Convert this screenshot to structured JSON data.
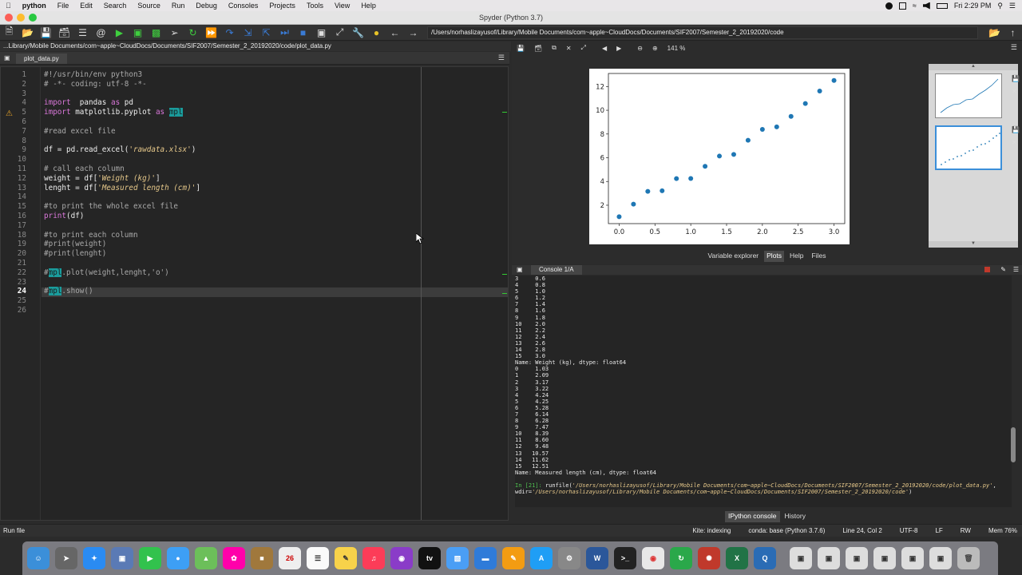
{
  "menubar": {
    "app": "python",
    "items": [
      "File",
      "Edit",
      "Search",
      "Source",
      "Run",
      "Debug",
      "Consoles",
      "Projects",
      "Tools",
      "View",
      "Help"
    ],
    "clock": "Fri 2:29 PM"
  },
  "window": {
    "title": "Spyder (Python 3.7)"
  },
  "toolbar": {
    "working_dir": "/Users/norhaslizayusof/Library/Mobile Documents/com~apple~CloudDocs/Documents/SIF2007/Semester_2_20192020/code"
  },
  "editor": {
    "file_path": "...Library/Mobile Documents/com~apple~CloudDocs/Documents/SIF2007/Semester_2_20192020/code/plot_data.py",
    "tab": "plot_data.py",
    "current_line": 24
  },
  "plots": {
    "zoom": "141 %",
    "tabs": [
      "Variable explorer",
      "Plots",
      "Help",
      "Files"
    ],
    "active_tab": "Plots"
  },
  "chart_data": {
    "type": "scatter",
    "x": [
      0.0,
      0.2,
      0.4,
      0.6,
      0.8,
      1.0,
      1.2,
      1.4,
      1.6,
      1.8,
      2.0,
      2.2,
      2.4,
      2.6,
      2.8,
      3.0
    ],
    "y": [
      1.03,
      2.09,
      3.17,
      3.22,
      4.24,
      4.25,
      5.28,
      6.14,
      6.28,
      7.47,
      8.39,
      8.6,
      9.48,
      10.57,
      11.62,
      12.51
    ],
    "xticks": [
      "0.0",
      "0.5",
      "1.0",
      "1.5",
      "2.0",
      "2.5",
      "3.0"
    ],
    "yticks": [
      "2",
      "4",
      "6",
      "8",
      "10",
      "12"
    ],
    "xlim": [
      -0.15,
      3.15
    ],
    "ylim": [
      0.45,
      13.1
    ],
    "marker_color": "#1f77b4"
  },
  "console": {
    "tab": "Console 1/A",
    "lines_top": [
      "3     0.6",
      "4     0.8",
      "5     1.0",
      "6     1.2",
      "7     1.4",
      "8     1.6",
      "9     1.8",
      "10    2.0",
      "11    2.2",
      "12    2.4",
      "13    2.6",
      "14    2.8",
      "15    3.0",
      "Name: Weight (kg), dtype: float64",
      "0     1.03",
      "1     2.09",
      "2     3.17",
      "3     3.22",
      "4     4.24",
      "5     4.25",
      "6     5.28",
      "7     6.14",
      "8     6.28",
      "9     7.47",
      "10    8.39",
      "11    8.60",
      "12    9.48",
      "13   10.57",
      "14   11.62",
      "15   12.51",
      "Name: Measured length (cm), dtype: float64"
    ],
    "prompt": "In [21]:",
    "run_cmd": "runfile(",
    "run_file": "'/Users/norhaslizayusof/Library/Mobile Documents/com~apple~CloudDocs/Documents/SIF2007/Semester_2_20192020/code/plot_data.py'",
    "run_mid": ",",
    "wdir_label": "wdir=",
    "wdir": "'/Users/norhaslizayusof/Library/Mobile Documents/com~apple~CloudDocs/Documents/SIF2007/Semester_2_20192020/code'",
    "run_end": ")",
    "tabs": [
      "IPython console",
      "History"
    ]
  },
  "status": {
    "left": "Run file",
    "kite": "Kite: indexing",
    "conda": "conda: base (Python 3.7.6)",
    "position": "Line 24, Col 2",
    "encoding": "UTF-8",
    "eol": "LF",
    "rw": "RW",
    "mem": "Mem 76%"
  }
}
